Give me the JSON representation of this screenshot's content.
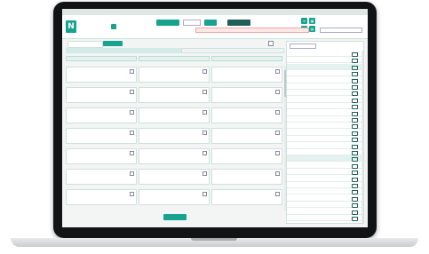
{
  "app": {
    "logo_letter": "N",
    "window_title": "",
    "breadcrumb": "",
    "page_title": "",
    "mode_badge": ""
  },
  "header": {
    "select_label": "",
    "dropdown_value": "",
    "button_teal": "",
    "button_dark": "",
    "warning": "",
    "user_name": "",
    "user_sub": ""
  },
  "left": {
    "tabs": [
      "",
      ""
    ],
    "checkbox_label": "",
    "strip_a": "",
    "strip_b": "",
    "columns": [
      {
        "title": "",
        "badge": ""
      },
      {
        "title": "",
        "badge": ""
      },
      {
        "title": "",
        "badge": ""
      }
    ],
    "add_button": ""
  },
  "cards": [
    {
      "name": "",
      "meta": "",
      "tag": "",
      "edit": ""
    },
    {
      "name": "",
      "meta": "",
      "tag": "",
      "edit": ""
    },
    {
      "name": "",
      "meta": "",
      "tag": "",
      "edit": ""
    },
    {
      "name": "",
      "meta": "",
      "tag": "",
      "edit": ""
    },
    {
      "name": "",
      "meta": "",
      "tag": "",
      "edit": ""
    },
    {
      "name": "",
      "meta": "",
      "tag": "",
      "edit": ""
    },
    {
      "name": "",
      "meta": "",
      "tag": "",
      "edit": ""
    },
    {
      "name": "",
      "meta": "",
      "tag": "",
      "edit": ""
    },
    {
      "name": "",
      "meta": "",
      "tag": "",
      "edit": ""
    },
    {
      "name": "",
      "meta": "",
      "tag": "",
      "edit": ""
    },
    {
      "name": "",
      "meta": "",
      "tag": "",
      "edit": ""
    },
    {
      "name": "",
      "meta": "",
      "tag": "",
      "edit": ""
    },
    {
      "name": "",
      "meta": "",
      "tag": "",
      "edit": ""
    },
    {
      "name": "",
      "meta": "",
      "tag": "",
      "edit": ""
    },
    {
      "name": "",
      "meta": "",
      "tag": "",
      "edit": ""
    },
    {
      "name": "",
      "meta": "",
      "tag": "",
      "edit": ""
    },
    {
      "name": "",
      "meta": "",
      "tag": "",
      "edit": ""
    },
    {
      "name": "",
      "meta": "",
      "tag": "",
      "edit": ""
    },
    {
      "name": "",
      "meta": "",
      "tag": "",
      "edit": ""
    },
    {
      "name": "",
      "meta": "",
      "tag": "",
      "edit": ""
    },
    {
      "name": "",
      "meta": "",
      "tag": "",
      "edit": ""
    }
  ],
  "right": {
    "select": "",
    "rows": [
      {
        "date": "",
        "place": ""
      },
      {
        "date": "",
        "place": ""
      },
      {
        "date": "",
        "place": ""
      },
      {
        "date": "",
        "place": ""
      },
      {
        "date": "",
        "place": ""
      },
      {
        "date": "",
        "place": ""
      },
      {
        "date": "",
        "place": ""
      },
      {
        "date": "",
        "place": ""
      },
      {
        "date": "",
        "place": ""
      },
      {
        "date": "",
        "place": ""
      },
      {
        "date": "",
        "place": ""
      },
      {
        "date": "",
        "place": ""
      },
      {
        "date": "",
        "place": ""
      },
      {
        "date": "",
        "place": ""
      },
      {
        "date": "",
        "place": ""
      },
      {
        "date": "",
        "place": ""
      },
      {
        "date": "",
        "place": ""
      },
      {
        "date": "",
        "place": ""
      },
      {
        "date": "",
        "place": ""
      },
      {
        "date": "",
        "place": ""
      },
      {
        "date": "",
        "place": ""
      },
      {
        "date": "",
        "place": ""
      },
      {
        "date": "",
        "place": ""
      },
      {
        "date": "",
        "place": ""
      },
      {
        "date": "",
        "place": ""
      },
      {
        "date": "",
        "place": ""
      }
    ]
  },
  "colors": {
    "accent": "#17a38f",
    "accent_dark": "#1f5f57",
    "warning": "#cc3333",
    "tag": "#e0a33b"
  }
}
